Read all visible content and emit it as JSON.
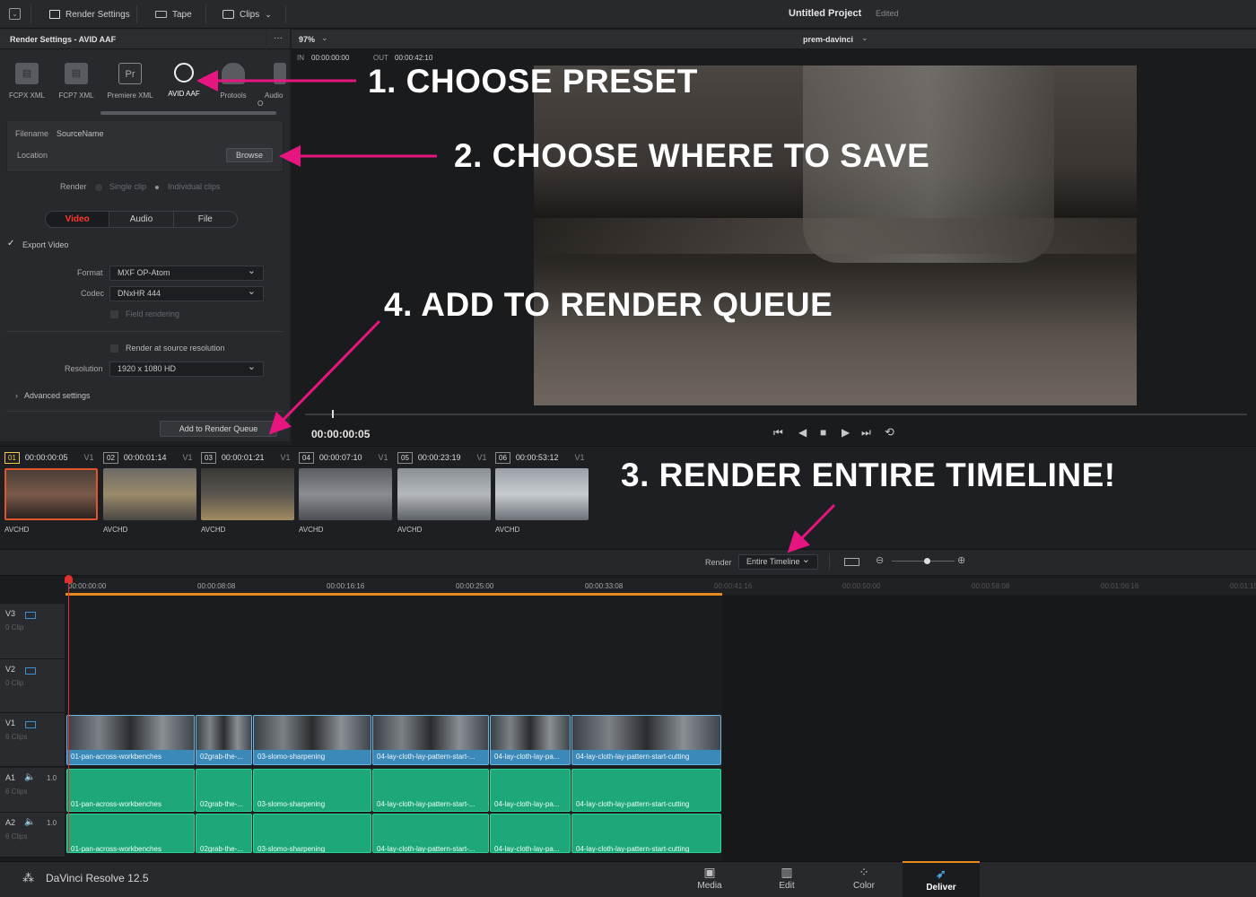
{
  "topbar": {
    "render_settings_label": "Render Settings",
    "tape_label": "Tape",
    "clips_label": "Clips",
    "project_title": "Untitled Project",
    "project_status": "Edited"
  },
  "left_panel": {
    "header": "Render Settings - AVID AAF",
    "menu_label": "···",
    "presets": [
      {
        "label": "FCPX XML",
        "icon": "clapperboard-icon"
      },
      {
        "label": "FCP7 XML",
        "icon": "clapperboard-icon"
      },
      {
        "label": "Premiere XML",
        "icon": "premiere-icon"
      },
      {
        "label": "AVID AAF",
        "icon": "avid-icon"
      },
      {
        "label": "Protools",
        "icon": "protools-icon"
      },
      {
        "label": "Audio O",
        "icon": "audio-icon"
      }
    ],
    "premiere_glyph": "Pr",
    "filename_label": "Filename",
    "filename_value": "SourceName",
    "location_label": "Location",
    "browse_label": "Browse",
    "render_label": "Render",
    "single_clip_label": "Single clip",
    "individual_clips_label": "Individual clips",
    "tabs": [
      "Video",
      "Audio",
      "File"
    ],
    "export_video_label": "Export Video",
    "format_label": "Format",
    "format_value": "MXF OP-Atom",
    "codec_label": "Codec",
    "codec_value": "DNxHR 444",
    "field_rendering_label": "Field rendering",
    "render_source_label": "Render at source resolution",
    "resolution_label": "Resolution",
    "resolution_value": "1920 x 1080 HD",
    "advanced_label": "Advanced settings",
    "add_queue_label": "Add to Render Queue"
  },
  "viewer": {
    "zoom": "97%",
    "timeline_name": "prem-davinci",
    "in_label": "IN",
    "in_tc": "00:00:00:00",
    "out_label": "OUT",
    "out_tc": "00:00:42:10",
    "current_tc": "00:00:00:05"
  },
  "annotations": {
    "a1": "1. CHOOSE PRESET",
    "a2": "2. CHOOSE WHERE TO SAVE",
    "a3": "3. RENDER ENTIRE TIMELINE!",
    "a4": "4. ADD TO RENDER QUEUE",
    "color": "#e6157f"
  },
  "clips": [
    {
      "num": "01",
      "tc": "00:00:00:05",
      "track": "V1",
      "codec": "AVCHD"
    },
    {
      "num": "02",
      "tc": "00:00:01:14",
      "track": "V1",
      "codec": "AVCHD"
    },
    {
      "num": "03",
      "tc": "00:00:01:21",
      "track": "V1",
      "codec": "AVCHD"
    },
    {
      "num": "04",
      "tc": "00:00:07:10",
      "track": "V1",
      "codec": "AVCHD"
    },
    {
      "num": "05",
      "tc": "00:00:23:19",
      "track": "V1",
      "codec": "AVCHD"
    },
    {
      "num": "06",
      "tc": "00:00:53:12",
      "track": "V1",
      "codec": "AVCHD"
    }
  ],
  "render_bar": {
    "render_label": "Render",
    "render_value": "Entire Timeline"
  },
  "ruler": [
    "00:00:00:00",
    "00:00:08:08",
    "00:00:16:16",
    "00:00:25:00",
    "00:00:33:08",
    "00:00:41:16",
    "00:00:50:00",
    "00:00:58:08",
    "00:01:06:16",
    "00:01:15"
  ],
  "tracks": {
    "v3": {
      "name": "V3",
      "count": "0 Clip"
    },
    "v2": {
      "name": "V2",
      "count": "0 Clip"
    },
    "v1": {
      "name": "V1",
      "count": "6 Clips"
    },
    "a1": {
      "name": "A1",
      "count": "6 Clips",
      "level": "1.0"
    },
    "a2": {
      "name": "A2",
      "count": "6 Clips",
      "level": "1.0"
    }
  },
  "timeline_clips": [
    "01-pan-across-workbenches",
    "02grab-the-...",
    "03-slomo-sharpening",
    "04-lay-cloth-lay-pattern-start-...",
    "04-lay-cloth-lay-pa...",
    "04-lay-cloth-lay-pattern-start-cutting"
  ],
  "app": {
    "name": "DaVinci Resolve 12.5"
  },
  "pages": [
    "Media",
    "Edit",
    "Color",
    "Deliver"
  ]
}
